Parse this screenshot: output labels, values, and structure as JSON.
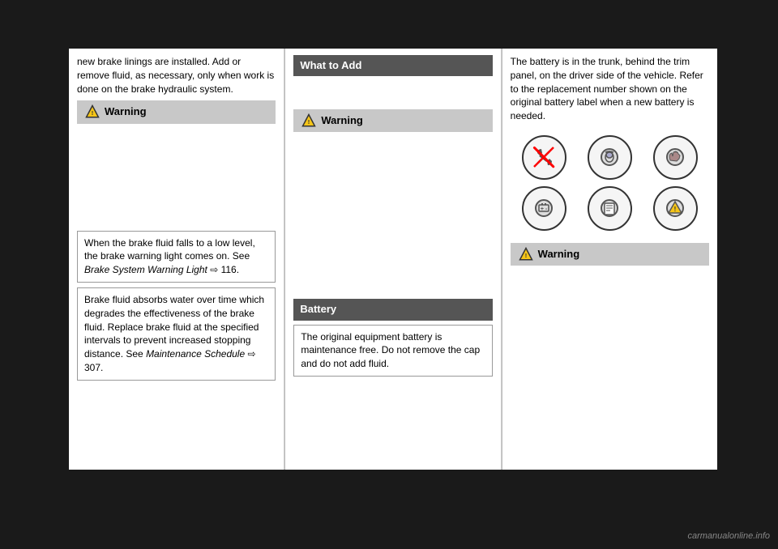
{
  "page": {
    "background": "#1a1a1a",
    "watermark": "carmanualonline.info"
  },
  "column1": {
    "intro_text": "new brake linings are installed. Add or remove fluid, as necessary, only when work is done on the brake hydraulic system.",
    "warning_label": "Warning",
    "brake_info_1": "When the brake fluid falls to a low level, the brake warning light comes on. See",
    "brake_info_1_italic": "Brake System Warning Light",
    "brake_info_1_ref": "116.",
    "brake_info_2": "Brake fluid absorbs water over time which degrades the effectiveness of the brake fluid. Replace brake fluid at the specified intervals to prevent increased stopping distance. See",
    "brake_info_2_italic": "Maintenance Schedule",
    "brake_info_2_ref": "307."
  },
  "column2": {
    "section_header": "What to Add",
    "warning_label": "Warning",
    "battery_section": "Battery",
    "battery_text": "The original equipment battery is maintenance free. Do not remove the cap and do not add fluid."
  },
  "column3": {
    "battery_location_text": "The battery is in the trunk, behind the trim panel, on the driver side of the vehicle. Refer to the replacement number shown on the original battery label when a new battery is needed.",
    "warning_label": "Warning",
    "icons": [
      {
        "symbol": "🔧",
        "strikethrough": true,
        "label": "no-tool-icon"
      },
      {
        "symbol": "👓",
        "strikethrough": false,
        "label": "safety-glasses-icon"
      },
      {
        "symbol": "🧤",
        "strikethrough": false,
        "label": "gloves-icon"
      },
      {
        "symbol": "🔋",
        "strikethrough": false,
        "label": "battery-icon"
      },
      {
        "symbol": "📖",
        "strikethrough": false,
        "label": "manual-icon"
      },
      {
        "symbol": "⚠️",
        "strikethrough": false,
        "label": "hazard-icon"
      }
    ]
  }
}
